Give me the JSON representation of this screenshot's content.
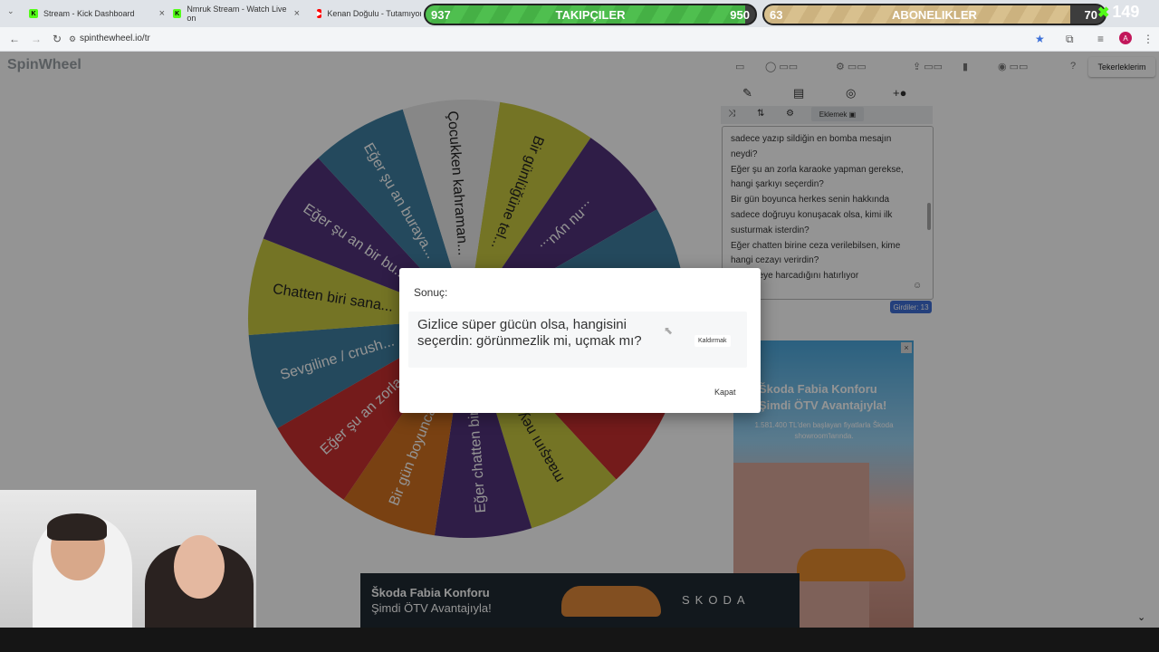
{
  "browser": {
    "tabs": [
      {
        "title": "Stream - Kick Dashboard",
        "favicon": "kick-icon",
        "color": "#53fc18"
      },
      {
        "title": "Nmruk Stream - Watch Live on",
        "favicon": "kick-icon",
        "color": "#53fc18"
      },
      {
        "title": "Kenan Doğulu - Tutamıyor",
        "favicon": "youtube-icon",
        "color": "#ff0000"
      }
    ],
    "url": "spinthewheel.io/tr",
    "profile_initial": "A"
  },
  "site": {
    "logo": "SpinWheel",
    "my_wheels": "Tekerleklerim"
  },
  "wheel": {
    "segments": [
      {
        "label": "Bir günlüğüne tel...",
        "color": "#c8c840"
      },
      {
        "label": "...nu uyu...",
        "color": "#51337a"
      },
      {
        "label": "...",
        "color": "#3f7fa0"
      },
      {
        "label": "...",
        "color": "#c8c840"
      },
      {
        "label": "...ten biri...",
        "color": "#c83030"
      },
      {
        "label": "maaşını neye ...",
        "color": "#c8c840"
      },
      {
        "label": "Eğer chatten biri...",
        "color": "#51337a"
      },
      {
        "label": "Bir gün boyunca h...",
        "color": "#d07020"
      },
      {
        "label": "Eğer şu an zorla ...",
        "color": "#c83030"
      },
      {
        "label": "Sevgiline / crush...",
        "color": "#3f7fa0"
      },
      {
        "label": "Chatten biri sana...",
        "color": "#c8c840"
      },
      {
        "label": "Eğer şu an bir bu...",
        "color": "#51337a"
      },
      {
        "label": "Eğer şu an buraya...",
        "color": "#3f7fa0"
      },
      {
        "label": "Çocukken kahraman...",
        "color": "#e8e8e8"
      }
    ]
  },
  "side_panel": {
    "add_label": "Eklemek",
    "entries_text": "sadece yazıp sildiğin en bomba mesajın neydi?\nEğer şu an zorla karaoke yapman gerekse, hangi şarkıyı seçerdin?\nBir gün boyunca herkes senin hakkında sadece doğruyu konuşacak olsa, kimi ilk susturmak isterdin?\nEğer chatten birine ceza verilebilsen, kime hangi cezayı verirdin?\n...anı neye harcadığını hatırlıyor",
    "entries_count": "Girdiler: 13"
  },
  "ads": {
    "right": {
      "line1": "Škoda Fabia Konforu",
      "line2": "Şimdi ÖTV Avantajıyla!",
      "line3": "1.581.400 TL'den başlayan fiyatlarla Škoda showroom'larında."
    },
    "bottom": {
      "line1": "Škoda Fabia Konforu",
      "line2": "Şimdi ÖTV Avantajıyla!",
      "brand": "SKODA"
    }
  },
  "dialog": {
    "title": "Sonuç:",
    "result": "Gizlice süper gücün olsa, hangisini seçerdin: görünmezlik mi, uçmak mı?",
    "remove_label": "Kaldırmak",
    "close_label": "Kapat"
  },
  "overlay_bars": {
    "followers": {
      "label": "TAKIPÇILER",
      "current": 937,
      "goal": 950,
      "progress": 0.97
    },
    "subscribers": {
      "label": "ABONELIKLER",
      "current": 63,
      "goal": 70,
      "progress": 0.9
    },
    "viewer_count": "149"
  }
}
